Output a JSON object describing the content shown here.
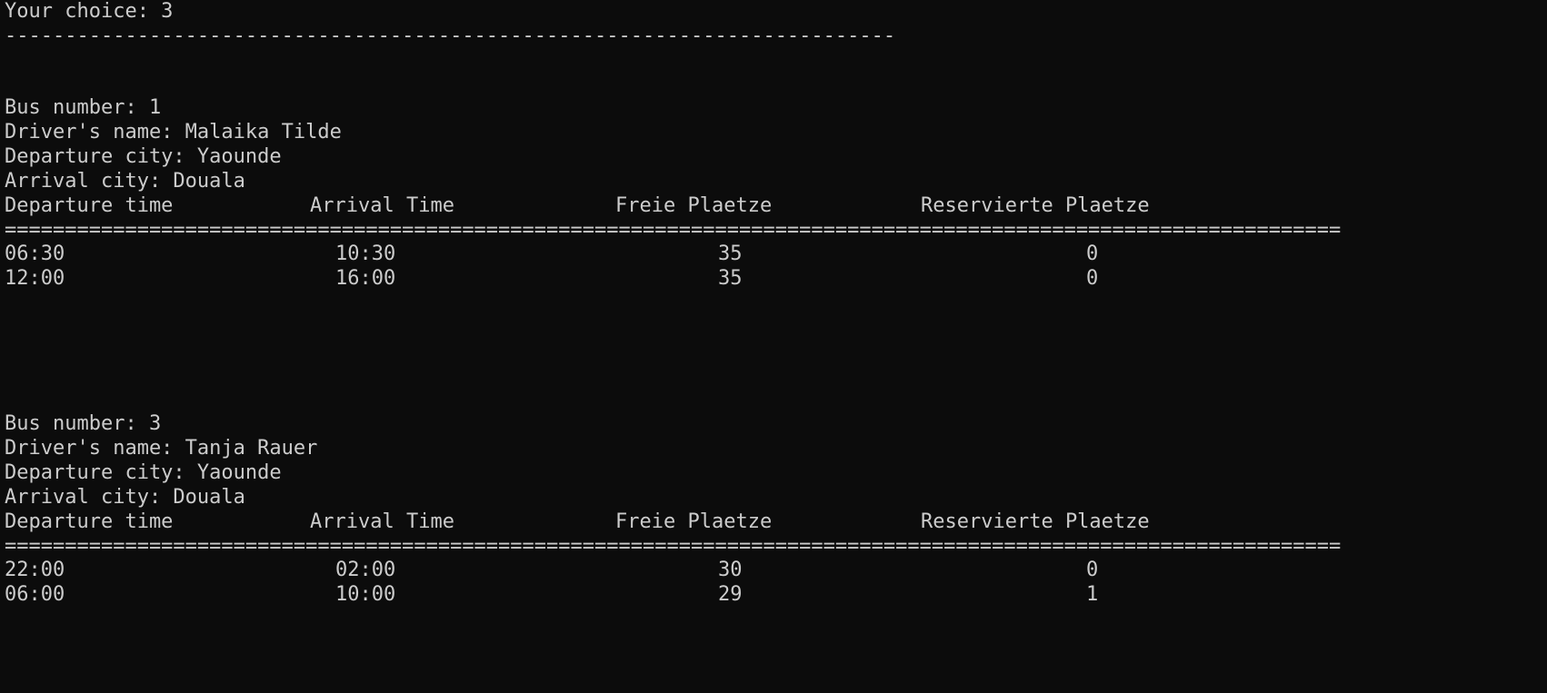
{
  "prompt": {
    "choice_label": "Your choice: 3",
    "separator": "--------------------------------------------------------------------------"
  },
  "buses": [
    {
      "bus_number": "Bus number: 1",
      "driver": "Driver's name: Malaika Tilde",
      "departure_city": "Departure city: Yaounde",
      "arrival_city": "Arrival city: Douala",
      "headers": [
        "Departure time",
        "Arrival Time",
        "Freie Plaetze",
        "Reservierte Plaetze"
      ],
      "separator": "===============================================================================================================",
      "rows": [
        {
          "departure": "06:30",
          "arrival": "10:30",
          "free": "35",
          "reserved": "0"
        },
        {
          "departure": "12:00",
          "arrival": "16:00",
          "free": "35",
          "reserved": "0"
        }
      ]
    },
    {
      "bus_number": "Bus number: 3",
      "driver": "Driver's name: Tanja Rauer",
      "departure_city": "Departure city: Yaounde",
      "arrival_city": "Arrival city: Douala",
      "headers": [
        "Departure time",
        "Arrival Time",
        "Freie Plaetze",
        "Reservierte Plaetze"
      ],
      "separator": "===============================================================================================================",
      "rows": [
        {
          "departure": "22:00",
          "arrival": "02:00",
          "free": "30",
          "reserved": "0"
        },
        {
          "departure": "06:00",
          "arrival": "10:00",
          "free": "29",
          "reserved": "1"
        }
      ]
    }
  ]
}
